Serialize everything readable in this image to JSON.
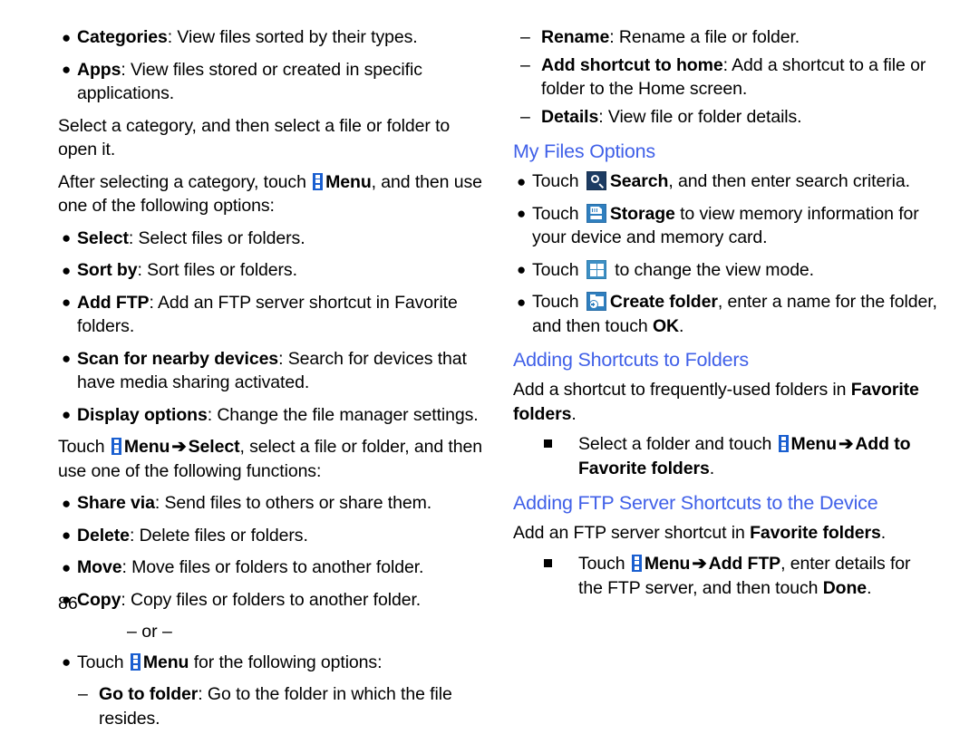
{
  "page_number": "86",
  "icons": {
    "menu": "menu-icon",
    "search": "search-icon",
    "storage": "storage-icon",
    "view_mode": "grid-view-icon",
    "create_folder": "create-folder-icon"
  },
  "colors": {
    "heading": "#4060e8",
    "menu_icon_blue": "#1a5fd0",
    "search_icon_navy": "#1d3c63",
    "chrome_icon_blue": "#2f7fbf"
  },
  "left_column": {
    "bullets_top": [
      {
        "term": "Categories",
        "rest": ": View files sorted by their types."
      },
      {
        "term": "Apps",
        "rest": ": View files stored or created in specific applications."
      }
    ],
    "para_select_category": "Select a category, and then select a file or folder to open it.",
    "para_after_selecting": {
      "pre": "After selecting a category, touch ",
      "bold1": "Menu",
      "post": ", and then use one of the following options:"
    },
    "options": [
      {
        "term": "Select",
        "rest": ": Select files or folders."
      },
      {
        "term": "Sort by",
        "rest": ": Sort files or folders."
      },
      {
        "term": "Add FTP",
        "rest": ": Add an FTP server shortcut in Favorite folders."
      },
      {
        "term": "Scan for nearby devices",
        "rest": ": Search for devices that have media sharing activated."
      },
      {
        "term": "Display options",
        "rest": ": Change the file manager settings."
      }
    ],
    "para_touch_menu_select": {
      "pre": "Touch ",
      "bold1": "Menu",
      "arrow": "➔",
      "bold2": "Select",
      "post": ", select a file or folder, and then use one of the following functions:"
    },
    "functions": [
      {
        "term": "Share via",
        "rest": ": Send files to others or share them."
      },
      {
        "term": "Delete",
        "rest": ": Delete files or folders."
      },
      {
        "term": "Move",
        "rest": ": Move files or folders to another folder."
      },
      {
        "term": "Copy",
        "rest": ": Copy files or folders to another folder."
      }
    ],
    "or_separator": "– or –",
    "touch_menu_options": {
      "pre": "Touch ",
      "bold1": "Menu",
      "post": " for the following options:"
    },
    "go_to_folder": {
      "dash": "–",
      "term": "Go to folder",
      "rest": ": Go to the folder in which the file resides."
    }
  },
  "right_column": {
    "sub_items": [
      {
        "dash": "–",
        "term": "Rename",
        "rest": ": Rename a file or folder."
      },
      {
        "dash": "–",
        "term": "Add shortcut to home",
        "rest": ": Add a shortcut to a file or folder to the Home screen."
      },
      {
        "dash": "–",
        "term": "Details",
        "rest": ": View file or folder details."
      }
    ],
    "heading_my_files_options": "My Files Options",
    "my_files_options": [
      {
        "pre": "Touch ",
        "icon": "search-icon",
        "bold": "Search",
        "post": ", and then enter search criteria."
      },
      {
        "pre": "Touch ",
        "icon": "storage-icon",
        "bold": "Storage",
        "post": " to view memory information for your device and memory card."
      },
      {
        "pre": "Touch ",
        "icon": "grid-view-icon",
        "bold": "",
        "post": " to change the view mode."
      },
      {
        "pre": "Touch ",
        "icon": "create-folder-icon",
        "bold": "Create folder",
        "post": ", enter a name for the folder, and then touch ",
        "post_bold": "OK",
        "post2": "."
      }
    ],
    "heading_adding_shortcuts": "Adding Shortcuts to Folders",
    "adding_shortcuts_para": {
      "pre": "Add a shortcut to frequently-used folders in ",
      "bold": "Favorite folders",
      "post": "."
    },
    "adding_shortcuts_step": {
      "pre": "Select a folder and touch ",
      "bold1": "Menu",
      "arrow": "➔",
      "bold2": "Add to Favorite folders",
      "post": "."
    },
    "heading_adding_ftp": "Adding FTP Server Shortcuts to the Device",
    "adding_ftp_para": {
      "pre": "Add an FTP server shortcut in ",
      "bold": "Favorite folders",
      "post": "."
    },
    "adding_ftp_step": {
      "pre": "Touch ",
      "bold1": "Menu",
      "arrow": "➔",
      "bold2": "Add FTP",
      "mid": ", enter details for the FTP server, and then touch ",
      "bold3": "Done",
      "post": "."
    }
  }
}
